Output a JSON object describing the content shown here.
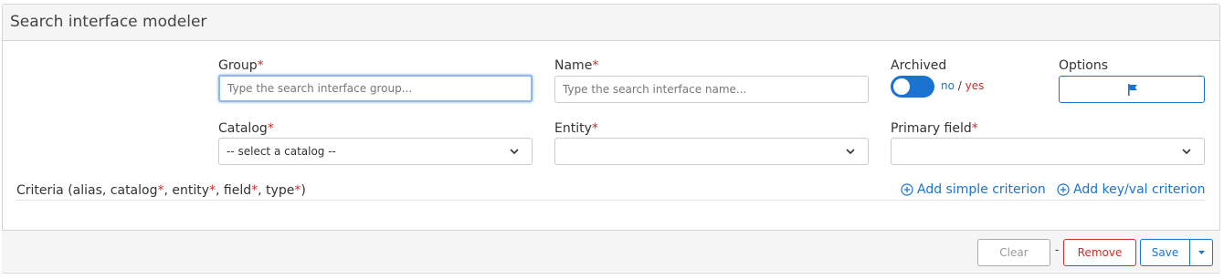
{
  "panel": {
    "title": "Search interface modeler"
  },
  "fields": {
    "group": {
      "label": "Group",
      "required_mark": "*",
      "placeholder": "Type the search interface group...",
      "value": ""
    },
    "name": {
      "label": "Name",
      "required_mark": "*",
      "placeholder": "Type the search interface name...",
      "value": ""
    },
    "archived": {
      "label": "Archived",
      "no": "no",
      "slash": " / ",
      "yes": "yes",
      "state": "no"
    },
    "options": {
      "label": "Options",
      "icon": "flag-icon"
    },
    "catalog": {
      "label": "Catalog",
      "required_mark": "*",
      "selected": "-- select a catalog --"
    },
    "entity": {
      "label": "Entity",
      "required_mark": "*",
      "selected": ""
    },
    "primary_field": {
      "label": "Primary field",
      "required_mark": "*",
      "selected": ""
    }
  },
  "criteria": {
    "label_parts": [
      "Criteria (alias, catalog",
      "*",
      ", entity",
      "*",
      ", field",
      "*",
      ", type",
      "*",
      ")"
    ],
    "add_simple": "Add simple criterion",
    "add_keyval": "Add key/val criterion"
  },
  "footer": {
    "clear": "Clear",
    "separator": "-",
    "remove": "Remove",
    "save": "Save"
  },
  "colors": {
    "accent": "#1a73d1",
    "danger": "#c9302c",
    "header_bg": "#f5f5f5"
  }
}
